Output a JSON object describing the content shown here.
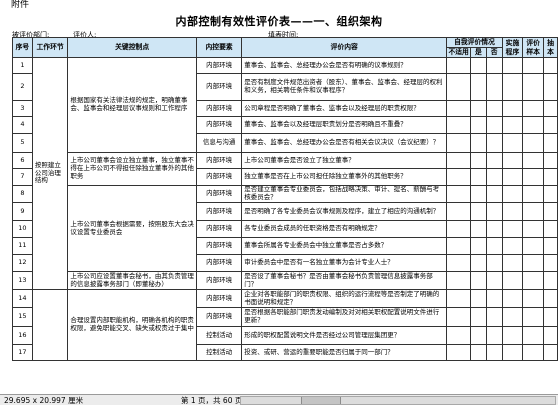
{
  "doc": {
    "header_label": "附件",
    "title": "内部控制有效性评价表——一、组织架构",
    "meta": {
      "dept_label": "被评价部门:",
      "person_label": "评价人:",
      "time_label": "填表时间:"
    }
  },
  "table": {
    "headers": {
      "no": "序号",
      "step": "工作环节",
      "key_point": "关键控制点",
      "element": "内控要素",
      "content": "评价内容",
      "self_eval": "自我评价情况",
      "na": "不适用",
      "yes": "是",
      "no_ans": "否",
      "procedure": "实施程序",
      "sample": "评价样本",
      "extra": "抽本"
    },
    "step_groups": [
      {
        "label": "按照建立公司治理结构"
      }
    ],
    "key_points": [
      {
        "label": "根据国家有关法律法规的规定，明确董事会、监事会和经理层议事规则和工作程序"
      },
      {
        "label": "上市公司董事会设立独立董事，独立董事不得在上市公司不得担任除独立董事外的其他职务"
      },
      {
        "label": "上市公司董事会根据需要，按照股东大会决议设置专业委员会"
      },
      {
        "label": "上市公司应设置董事会秘书，由其负责管理的信息披露事务部门（即董秘办）"
      },
      {
        "label": "合理设置内部职能机构，明确各机构的职责权限，避免职能交叉、缺失或权责过于集中"
      }
    ],
    "rows": [
      {
        "no": "1",
        "element": "内部环境",
        "content": "董事会、监事会、总经理办公会是否有明确的议事规则？"
      },
      {
        "no": "2",
        "element": "内部环境",
        "content": "是否有制度文件规范出资者（股东）、董事会、监事会、经理层的权利和义务，相关聘任条件和议事程序？"
      },
      {
        "no": "3",
        "element": "内部环境",
        "content": "公司章程是否明确了董事会、监事会以及经理层的职责权限？"
      },
      {
        "no": "4",
        "element": "内部环境",
        "content": "董事会、监事会以及经理层职责划分是否明确且不重叠？"
      },
      {
        "no": "5",
        "element": "信息与沟通",
        "content": "董事会、监事会、总经理办公会是否有相关会议决议（会议纪要）？"
      },
      {
        "no": "6",
        "element": "内部环境",
        "content": "上市公司董事会是否设立了独立董事？"
      },
      {
        "no": "7",
        "element": "内部环境",
        "content": "独立董事是否在上市公司担任除独立董事外的其他职务？"
      },
      {
        "no": "8",
        "element": "内部环境",
        "content": "是否建立董事会专业委员会，包括战略决策、审计、提名、薪酬与考核委员会？"
      },
      {
        "no": "9",
        "element": "内部环境",
        "content": "是否明确了各专业委员会议事规则及程序，建立了相应的沟通机制？"
      },
      {
        "no": "10",
        "element": "内部环境",
        "content": "各专业委员会成员的任职资格是否有明确规定？"
      },
      {
        "no": "11",
        "element": "内部环境",
        "content": "董事会所属各专业委员会中独立董事是否占多数？"
      },
      {
        "no": "12",
        "element": "内部环境",
        "content": "审计委员会中是否有一名独立董事为会计专业人士？"
      },
      {
        "no": "13",
        "element": "内部环境",
        "content": "是否设了董事会秘书？是否由董事会秘书负责管理信息披露事务部门？"
      },
      {
        "no": "14",
        "element": "内部环境",
        "content": "企业对各职能部门的职责权限、组织的运行流程等是否制定了明确的书面说明和规定？"
      },
      {
        "no": "15",
        "element": "内部环境",
        "content": "是否根据各职能部门职责发动编制及对对相关职权配置说明文件进行更新？"
      },
      {
        "no": "16",
        "element": "控制活动",
        "content": "形成的职权配置说明文件是否经过公司管理层集团更？"
      },
      {
        "no": "17",
        "element": "控制活动",
        "content": "投资、或研、营运的重要职能是否归属于同一部门？"
      }
    ]
  },
  "statusbar": {
    "page_size": "29.695 x 20.997 厘米",
    "page_indicator": "第 1 页，共 60 页"
  }
}
